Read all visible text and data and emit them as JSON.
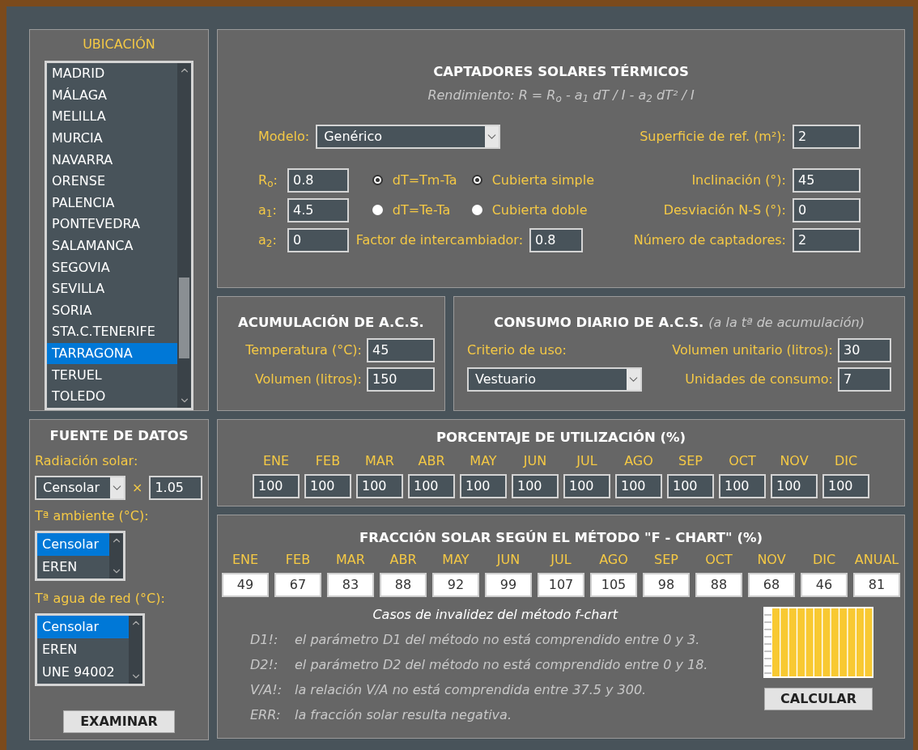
{
  "location": {
    "title": "UBICACIÓN",
    "items": [
      {
        "label": "MADRID",
        "selected": false
      },
      {
        "label": "MÁLAGA",
        "selected": false
      },
      {
        "label": "MELILLA",
        "selected": false
      },
      {
        "label": "MURCIA",
        "selected": false
      },
      {
        "label": "NAVARRA",
        "selected": false
      },
      {
        "label": "ORENSE",
        "selected": false
      },
      {
        "label": "PALENCIA",
        "selected": false
      },
      {
        "label": "PONTEVEDRA",
        "selected": false
      },
      {
        "label": "SALAMANCA",
        "selected": false
      },
      {
        "label": "SEGOVIA",
        "selected": false
      },
      {
        "label": "SEVILLA",
        "selected": false
      },
      {
        "label": "SORIA",
        "selected": false
      },
      {
        "label": "STA.C.TENERIFE",
        "selected": false
      },
      {
        "label": "TARRAGONA",
        "selected": true
      },
      {
        "label": "TERUEL",
        "selected": false
      },
      {
        "label": "TOLEDO",
        "selected": false
      }
    ]
  },
  "data_source": {
    "title": "FUENTE DE DATOS",
    "radiation": {
      "label": "Radiación solar:",
      "select": "Censolar",
      "sign": "×",
      "factor": "1.05"
    },
    "ambient": {
      "label": "Tª ambiente (°C):",
      "items": [
        {
          "label": "Censolar",
          "selected": true
        },
        {
          "label": "EREN",
          "selected": false
        }
      ]
    },
    "network_water": {
      "label": "Tª agua de red (°C):",
      "items": [
        {
          "label": "Censolar",
          "selected": true
        },
        {
          "label": "EREN",
          "selected": false
        },
        {
          "label": "UNE 94002",
          "selected": false
        }
      ]
    },
    "button": "EXAMINAR"
  },
  "collectors": {
    "title": "CAPTADORES SOLARES TÉRMICOS",
    "formula": "Rendimiento: R = R$_{o}$ - a$_{1}$ dT / I - a$_{2}$ dT² / I",
    "model": {
      "label": "Modelo:",
      "value": "Genérico"
    },
    "coefficients": [
      {
        "label": "R$_{o}$:",
        "value": "0.8"
      },
      {
        "label": "a$_{1}$:",
        "value": "4.5"
      },
      {
        "label": "a$_{2}$:",
        "value": "0"
      }
    ],
    "dt_options": [
      {
        "label": "dT=Tm-Ta",
        "selected": true
      },
      {
        "label": "dT=Te-Ta",
        "selected": false
      }
    ],
    "cover_options": [
      {
        "label": "Cubierta simple",
        "selected": true
      },
      {
        "label": "Cubierta doble",
        "selected": false
      }
    ],
    "exchanger": {
      "label": "Factor de intercambiador:",
      "value": "0.8"
    },
    "fields": [
      {
        "label": "Superficie de ref. (m²):",
        "value": "2"
      },
      {
        "label": "Inclinación (°):",
        "value": "45"
      },
      {
        "label": "Desviación N-S (°):",
        "value": "0"
      },
      {
        "label": "Número de captadores:",
        "value": "2"
      }
    ]
  },
  "storage": {
    "title": "ACUMULACIÓN DE A.C.S.",
    "fields": [
      {
        "label": "Temperatura (°C):",
        "value": "45"
      },
      {
        "label": "Volumen (litros):",
        "value": "150"
      }
    ]
  },
  "consumption": {
    "title": "CONSUMO DIARIO DE A.C.S.",
    "note": "(a la tª de acumulación)",
    "criterion_label": "Criterio de uso:",
    "criterion": "Vestuario",
    "fields": [
      {
        "label": "Volumen unitario (litros):",
        "value": "30"
      },
      {
        "label": "Unidades de consumo:",
        "value": "7"
      }
    ]
  },
  "utilization": {
    "title": "PORCENTAJE DE UTILIZACIÓN (%)",
    "months": [
      {
        "month": "ENE",
        "value": "100"
      },
      {
        "month": "FEB",
        "value": "100"
      },
      {
        "month": "MAR",
        "value": "100"
      },
      {
        "month": "ABR",
        "value": "100"
      },
      {
        "month": "MAY",
        "value": "100"
      },
      {
        "month": "JUN",
        "value": "100"
      },
      {
        "month": "JUL",
        "value": "100"
      },
      {
        "month": "AGO",
        "value": "100"
      },
      {
        "month": "SEP",
        "value": "100"
      },
      {
        "month": "OCT",
        "value": "100"
      },
      {
        "month": "NOV",
        "value": "100"
      },
      {
        "month": "DIC",
        "value": "100"
      }
    ]
  },
  "fchart": {
    "title": "FRACCIÓN SOLAR SEGÚN EL MÉTODO \"F - CHART\" (%)",
    "months": [
      {
        "month": "ENE",
        "value": "49"
      },
      {
        "month": "FEB",
        "value": "67"
      },
      {
        "month": "MAR",
        "value": "83"
      },
      {
        "month": "ABR",
        "value": "88"
      },
      {
        "month": "MAY",
        "value": "92"
      },
      {
        "month": "JUN",
        "value": "99"
      },
      {
        "month": "JUL",
        "value": "107"
      },
      {
        "month": "AGO",
        "value": "105"
      },
      {
        "month": "SEP",
        "value": "98"
      },
      {
        "month": "OCT",
        "value": "88"
      },
      {
        "month": "NOV",
        "value": "68"
      },
      {
        "month": "DIC",
        "value": "46"
      },
      {
        "month": "ANUAL",
        "value": "81"
      }
    ],
    "invalid_title": "Casos de invalidez del método f-chart",
    "invalid_cases": [
      {
        "code": "D1!:",
        "text": "el parámetro D1 del método no está comprendido entre 0 y 3."
      },
      {
        "code": "D2!:",
        "text": "el parámetro D2 del método no está comprendido entre 0 y 18."
      },
      {
        "code": "V/A!:",
        "text": "la relación V/A no está comprendida entre 37.5 y 300."
      },
      {
        "code": "ERR:",
        "text": "la fracción solar resulta negativa."
      }
    ],
    "button": "CALCULAR"
  }
}
